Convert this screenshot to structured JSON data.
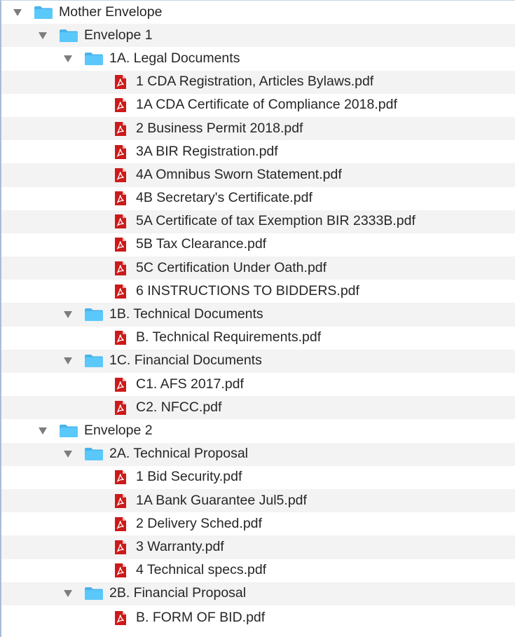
{
  "colors": {
    "folder": "#5ac8fa",
    "folder_tab": "#4ab3ea",
    "pdf": "#cc1a1a",
    "alt_row": "#f3f3f3",
    "text": "#262626",
    "disclosure": "#7d7d7d"
  },
  "tree": {
    "rows": [
      {
        "label": "Mother Envelope",
        "kind": "folder",
        "depth": 0,
        "expanded": true,
        "icon": "folder-icon"
      },
      {
        "label": "Envelope 1",
        "kind": "folder",
        "depth": 1,
        "expanded": true,
        "icon": "folder-icon"
      },
      {
        "label": "1A. Legal Documents",
        "kind": "folder",
        "depth": 2,
        "expanded": true,
        "icon": "folder-icon"
      },
      {
        "label": "1 CDA Registration, Articles Bylaws.pdf",
        "kind": "file",
        "depth": 3,
        "icon": "pdf-file-icon"
      },
      {
        "label": "1A CDA Certificate of Compliance 2018.pdf",
        "kind": "file",
        "depth": 3,
        "icon": "pdf-file-icon"
      },
      {
        "label": "2 Business Permit 2018.pdf",
        "kind": "file",
        "depth": 3,
        "icon": "pdf-file-icon"
      },
      {
        "label": "3A BIR Registration.pdf",
        "kind": "file",
        "depth": 3,
        "icon": "pdf-file-icon"
      },
      {
        "label": "4A Omnibus Sworn Statement.pdf",
        "kind": "file",
        "depth": 3,
        "icon": "pdf-file-icon"
      },
      {
        "label": "4B Secretary's Certificate.pdf",
        "kind": "file",
        "depth": 3,
        "icon": "pdf-file-icon"
      },
      {
        "label": "5A Certificate of tax Exemption BIR 2333B.pdf",
        "kind": "file",
        "depth": 3,
        "icon": "pdf-file-icon"
      },
      {
        "label": "5B Tax Clearance.pdf",
        "kind": "file",
        "depth": 3,
        "icon": "pdf-file-icon"
      },
      {
        "label": "5C Certification Under Oath.pdf",
        "kind": "file",
        "depth": 3,
        "icon": "pdf-file-icon"
      },
      {
        "label": "6 INSTRUCTIONS TO BIDDERS.pdf",
        "kind": "file",
        "depth": 3,
        "icon": "pdf-file-icon"
      },
      {
        "label": "1B. Technical Documents",
        "kind": "folder",
        "depth": 2,
        "expanded": true,
        "icon": "folder-icon"
      },
      {
        "label": "B. Technical Requirements.pdf",
        "kind": "file",
        "depth": 3,
        "icon": "pdf-file-icon"
      },
      {
        "label": "1C. Financial Documents",
        "kind": "folder",
        "depth": 2,
        "expanded": true,
        "icon": "folder-icon"
      },
      {
        "label": "C1. AFS 2017.pdf",
        "kind": "file",
        "depth": 3,
        "icon": "pdf-file-icon"
      },
      {
        "label": "C2. NFCC.pdf",
        "kind": "file",
        "depth": 3,
        "icon": "pdf-file-icon"
      },
      {
        "label": "Envelope 2",
        "kind": "folder",
        "depth": 1,
        "expanded": true,
        "icon": "folder-icon"
      },
      {
        "label": "2A. Technical Proposal",
        "kind": "folder",
        "depth": 2,
        "expanded": true,
        "icon": "folder-icon"
      },
      {
        "label": "1 Bid Security.pdf",
        "kind": "file",
        "depth": 3,
        "icon": "pdf-file-icon"
      },
      {
        "label": "1A Bank Guarantee Jul5.pdf",
        "kind": "file",
        "depth": 3,
        "icon": "pdf-file-icon"
      },
      {
        "label": "2 Delivery Sched.pdf",
        "kind": "file",
        "depth": 3,
        "icon": "pdf-file-icon"
      },
      {
        "label": "3 Warranty.pdf",
        "kind": "file",
        "depth": 3,
        "icon": "pdf-file-icon"
      },
      {
        "label": "4 Technical specs.pdf",
        "kind": "file",
        "depth": 3,
        "icon": "pdf-file-icon"
      },
      {
        "label": "2B. Financial Proposal",
        "kind": "folder",
        "depth": 2,
        "expanded": true,
        "icon": "folder-icon"
      },
      {
        "label": "B. FORM OF BID.pdf",
        "kind": "file",
        "depth": 3,
        "icon": "pdf-file-icon"
      }
    ]
  }
}
